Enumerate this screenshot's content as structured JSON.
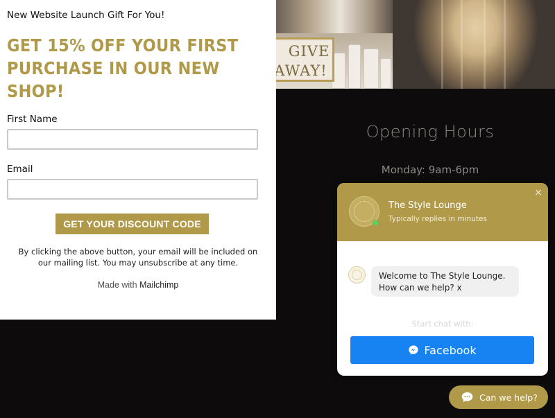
{
  "site": {
    "giveaway_sign": {
      "line1": "GIVE",
      "line2": "AWAY!"
    },
    "opening_hours": {
      "title": "Opening Hours",
      "lines": [
        "Monday: 9am-6pm"
      ]
    }
  },
  "popup": {
    "eyebrow": "New Website Launch Gift For You!",
    "headline": "GET 15% OFF YOUR FIRST PURCHASE IN OUR NEW SHOP!",
    "first_name_label": "First Name",
    "first_name_value": "",
    "email_label": "Email",
    "email_value": "",
    "submit_label": "GET YOUR DISCOUNT CODE",
    "disclaimer": "By clicking the above button, your email will be included on our mailing list. You may unsubscribe at any time.",
    "made_with_prefix": "Made with",
    "made_with_brand": "Mailchimp"
  },
  "chat": {
    "business_name": "The Style Lounge",
    "status": "Typically replies in minutes",
    "close_glyph": "×",
    "welcome_message": "Welcome to The Style Lounge. How can we help? x",
    "start_chat_label": "Start chat with:",
    "facebook_label": "Facebook",
    "help_pill_label": "Can we help?"
  },
  "colors": {
    "brand_gold": "#b09a49",
    "facebook_blue": "#1783f2",
    "page_background": "#0d0b0c",
    "online_green": "#4cd964"
  },
  "icons": {
    "close": "close-icon",
    "messenger": "messenger-icon",
    "chat_bubble": "chat-bubble-icon"
  }
}
